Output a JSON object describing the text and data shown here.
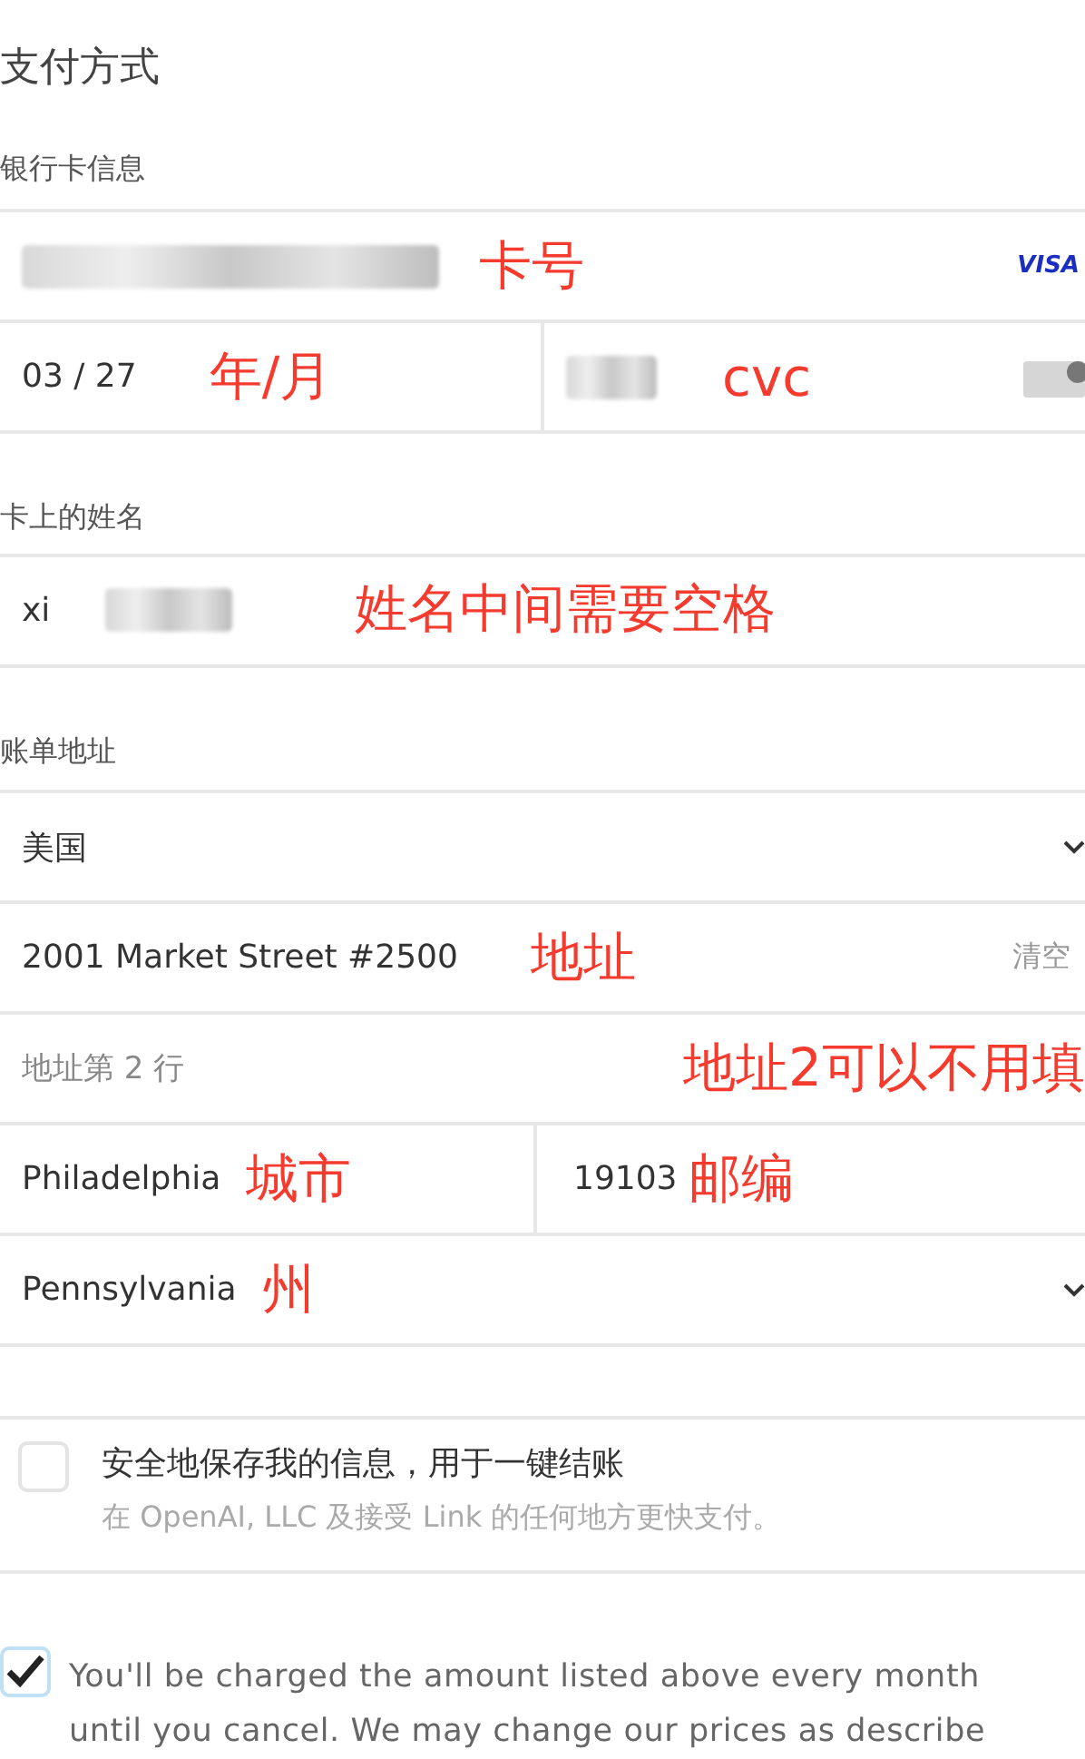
{
  "title": "支付方式",
  "card_section": {
    "label": "银行卡信息",
    "expiry": {
      "value": "03 / 27",
      "annotation": "年/月"
    },
    "number_annotation": "卡号",
    "cvc_annotation": "cvc",
    "brand": "VISA"
  },
  "name_section": {
    "label": "卡上的姓名",
    "value": "xi",
    "annotation": "姓名中间需要空格"
  },
  "billing_section": {
    "label": "账单地址",
    "country": {
      "value": "美国"
    },
    "address_line1": {
      "value": "2001 Market Street #2500",
      "annotation": "地址",
      "clear": "清空"
    },
    "address_line2": {
      "placeholder": "地址第 2 行",
      "annotation": "地址2可以不用填"
    },
    "city": {
      "value": "Philadelphia",
      "annotation": "城市"
    },
    "zip": {
      "value": "19103",
      "annotation": "邮编"
    },
    "state": {
      "value": "Pennsylvania",
      "annotation": "州"
    }
  },
  "save_info": {
    "checked": false,
    "title": "安全地保存我的信息，用于一键结账",
    "subtitle": "在 OpenAI, LLC 及接受 Link 的任何地方更快支付。"
  },
  "terms": {
    "checked": true,
    "text": "You'll be charged the amount listed above every month until you cancel. We may change our prices as describe"
  }
}
